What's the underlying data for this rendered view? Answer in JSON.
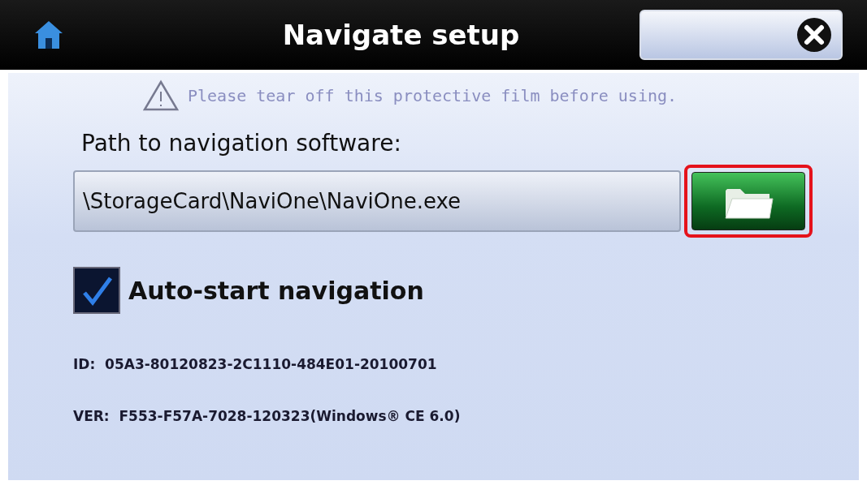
{
  "window": {
    "title": "Navigate setup"
  },
  "notice": "Please tear off this protective film before using.",
  "path": {
    "label": "Path to navigation software:",
    "value": "\\StorageCard\\NaviOne\\NaviOne.exe",
    "browse_highlighted": true
  },
  "auto_start": {
    "label": "Auto-start navigation",
    "checked": true
  },
  "info": [
    "ID:  05A3-80120823-2C1110-484E01-20100701",
    "VER:  F553-F57A-7028-120323(Windows® CE 6.0)"
  ]
}
